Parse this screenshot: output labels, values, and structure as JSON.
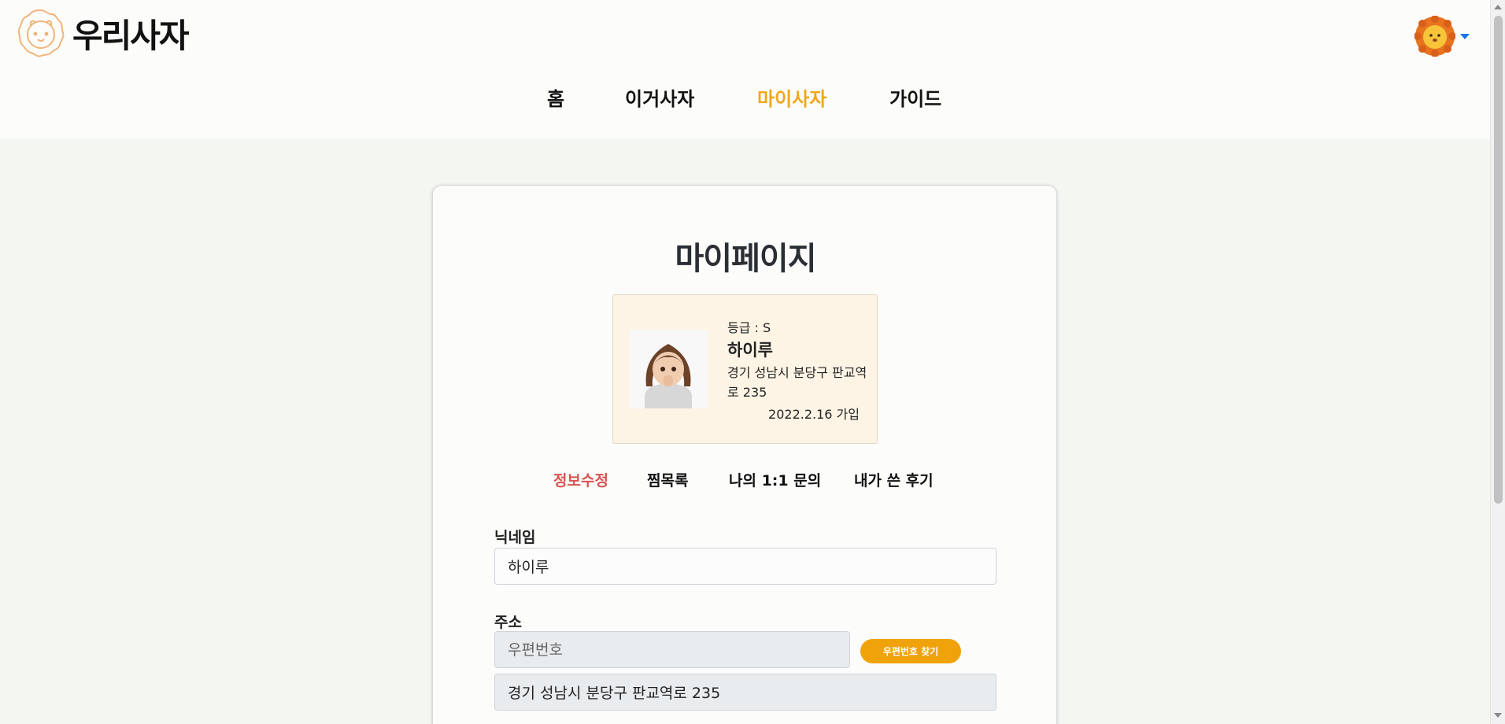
{
  "brand": {
    "name": "우리사자"
  },
  "nav": {
    "items": [
      "홈",
      "이거사자",
      "마이사자",
      "가이드"
    ],
    "active": "마이사자"
  },
  "page": {
    "title": "마이페이지"
  },
  "profile": {
    "grade": "등급 : S",
    "name": "하이루",
    "address": "경기 성남시 분당구 판교역로 235",
    "joined": "2022.2.16 가입"
  },
  "tabs": {
    "items": [
      "정보수정",
      "찜목록",
      "나의 1:1 문의",
      "내가 쓴 후기"
    ],
    "active": "정보수정"
  },
  "form": {
    "nickname_label": "닉네임",
    "nickname_value": "하이루",
    "address_label": "주소",
    "postal_placeholder": "우편번호",
    "postal_button": "우편번호 찾기",
    "address_value": "경기 성남시 분당구 판교역로 235"
  },
  "colors": {
    "accent": "#f0a81c",
    "active_tab": "#d9534f",
    "button": "#f0a20b"
  },
  "icons": {
    "logo": "lion-logo-icon",
    "user": "lion-avatar-icon",
    "dropdown": "caret-down-icon"
  }
}
